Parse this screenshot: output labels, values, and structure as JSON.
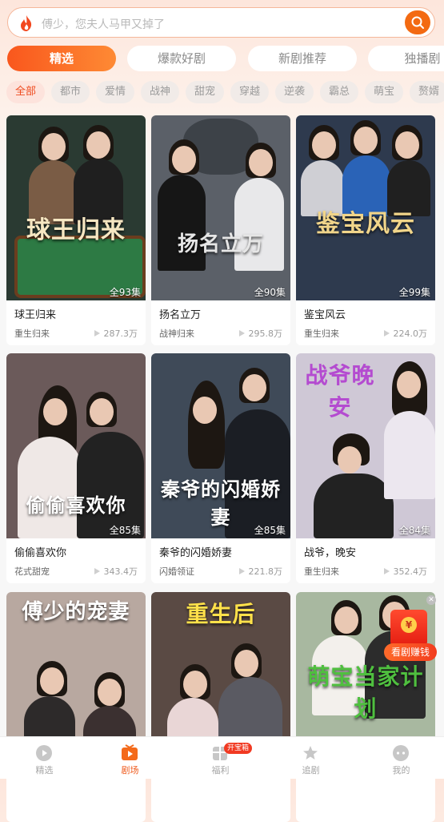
{
  "search": {
    "placeholder": "傅少，您夫人马甲又掉了"
  },
  "tabs": [
    {
      "label": "精选",
      "active": true
    },
    {
      "label": "爆款好剧",
      "active": false
    },
    {
      "label": "新剧推荐",
      "active": false
    },
    {
      "label": "独播剧",
      "active": false
    }
  ],
  "chips": [
    {
      "label": "全部",
      "active": true
    },
    {
      "label": "都市"
    },
    {
      "label": "爱情"
    },
    {
      "label": "战神"
    },
    {
      "label": "甜宠"
    },
    {
      "label": "穿越"
    },
    {
      "label": "逆袭"
    },
    {
      "label": "霸总"
    },
    {
      "label": "萌宝"
    },
    {
      "label": "赘婿"
    }
  ],
  "cards": [
    {
      "title": "球王归来",
      "tag": "重生归来",
      "views": "287.3万",
      "episodes": "全93集",
      "cover_title": "球王归来",
      "bg": "#2a3a32"
    },
    {
      "title": "扬名立万",
      "tag": "战神归来",
      "views": "295.8万",
      "episodes": "全90集",
      "cover_title": "扬名立万",
      "bg": "#5b6068"
    },
    {
      "title": "鉴宝风云",
      "tag": "重生归来",
      "views": "224.0万",
      "episodes": "全99集",
      "cover_title": "鉴宝风云",
      "bg": "#2e3a4e"
    },
    {
      "title": "偷偷喜欢你",
      "tag": "花式甜宠",
      "views": "343.4万",
      "episodes": "全85集",
      "cover_title": "偷偷喜欢你",
      "bg": "#6b5a5a"
    },
    {
      "title": "秦爷的闪婚娇妻",
      "tag": "闪婚领证",
      "views": "221.8万",
      "episodes": "全85集",
      "cover_title": "秦爷的闪婚娇妻",
      "bg": "#3f4a58"
    },
    {
      "title": "战爷，晚安",
      "tag": "重生归来",
      "views": "352.4万",
      "episodes": "全84集",
      "cover_title": "战爷晚安",
      "bg": "#cfc8d6"
    },
    {
      "title": "",
      "tag": "",
      "views": "",
      "episodes": "",
      "cover_title": "傅少的宠妻",
      "bg": "#b8a8a0"
    },
    {
      "title": "",
      "tag": "",
      "views": "",
      "episodes": "",
      "cover_title": "重生后",
      "bg": "#5a4a44"
    },
    {
      "title": "",
      "tag": "",
      "views": "",
      "episodes": "",
      "cover_title": "萌宝当家计划",
      "bg": "#a8b8a0"
    }
  ],
  "bonus": {
    "label": "看剧赚钱",
    "coin": "¥"
  },
  "bottom_nav": [
    {
      "label": "精选",
      "icon": "play-circle-icon",
      "active": false
    },
    {
      "label": "剧场",
      "icon": "theater-icon",
      "active": true
    },
    {
      "label": "福利",
      "icon": "gift-icon",
      "active": false,
      "badge": "开宝箱"
    },
    {
      "label": "追剧",
      "icon": "star-hat-icon",
      "active": false
    },
    {
      "label": "我的",
      "icon": "profile-icon",
      "active": false
    }
  ],
  "colors": {
    "accent": "#f36a12",
    "active_chip": "#ef4b1f"
  }
}
